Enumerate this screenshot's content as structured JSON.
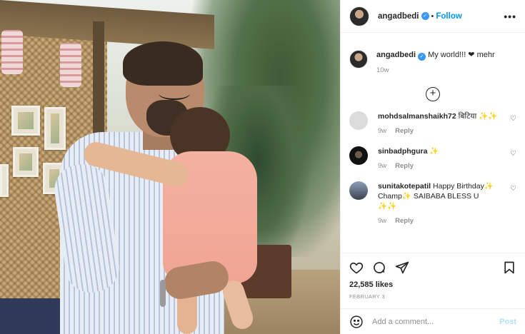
{
  "post": {
    "author": "angadbedi",
    "follow_label": "Follow",
    "separator": "•",
    "more_label": "•••"
  },
  "caption": {
    "username": "angadbedi",
    "text": "My world!!! ❤ mehr",
    "time": "10w"
  },
  "load_more": "+",
  "comments": [
    {
      "username": "mohdsalmanshaikh72",
      "text": "बिटिया ✨✨",
      "time": "9w",
      "reply_label": "Reply"
    },
    {
      "username": "sinbadphgura",
      "text": "✨",
      "time": "9w",
      "reply_label": "Reply"
    },
    {
      "username": "sunitakotepatil",
      "text": "Happy Birthday✨ Champ✨ SAIBABA BLESS U ✨✨",
      "time": "9w",
      "reply_label": "Reply"
    }
  ],
  "stats": {
    "likes": "22,585 likes",
    "date": "FEBRUARY 3"
  },
  "composer": {
    "placeholder": "Add a comment...",
    "post_label": "Post"
  },
  "colors": {
    "link_blue": "#0095f6",
    "verified_blue": "#3897f0",
    "muted": "#8e8e8e",
    "post_disabled": "#b2dffc"
  }
}
